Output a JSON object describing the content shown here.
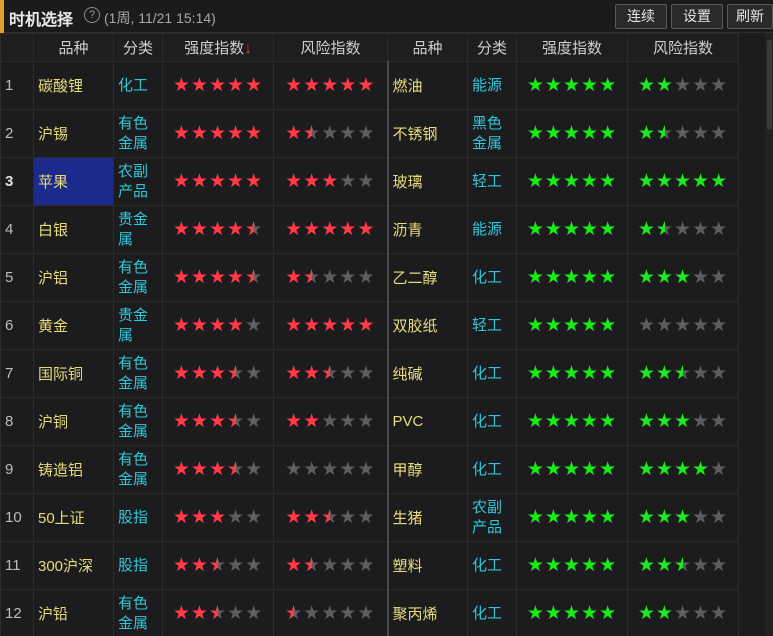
{
  "header": {
    "title": "时机选择",
    "subtitle": "(1周, 11/21 15:14)",
    "buttons": {
      "continuous": "连续",
      "settings": "设置",
      "refresh": "刷新"
    }
  },
  "columns": {
    "name": "品种",
    "category": "分类",
    "strength": "强度指数",
    "strength_sort": "↓",
    "risk": "风险指数",
    "name2": "品种",
    "category2": "分类",
    "strength2": "强度指数",
    "risk2": "风险指数"
  },
  "colors": {
    "strength_left": "#ff3b46",
    "risk_left": "#ff3b46",
    "right": "#1aeb1a",
    "empty": "#5e5e60",
    "selected": "#1b2a8c"
  },
  "rows": [
    {
      "idx": "1",
      "left": {
        "name": "碳酸锂",
        "cat": "化工",
        "strength": 5,
        "risk": 5
      },
      "right": {
        "name": "燃油",
        "cat": "能源",
        "strength": 5,
        "risk": 2
      }
    },
    {
      "idx": "2",
      "left": {
        "name": "沪锡",
        "cat": "有色金属",
        "strength": 5,
        "risk": 1.5
      },
      "right": {
        "name": "不锈钢",
        "cat": "黑色金属",
        "strength": 5,
        "risk": 1.5
      }
    },
    {
      "idx": "3",
      "left": {
        "name": "苹果",
        "cat": "农副产品",
        "strength": 5,
        "risk": 3
      },
      "right": {
        "name": "玻璃",
        "cat": "轻工",
        "strength": 5,
        "risk": 5
      }
    },
    {
      "idx": "4",
      "left": {
        "name": "白银",
        "cat": "贵金属",
        "strength": 4.5,
        "risk": 5
      },
      "right": {
        "name": "沥青",
        "cat": "能源",
        "strength": 5,
        "risk": 1.5
      }
    },
    {
      "idx": "5",
      "left": {
        "name": "沪铝",
        "cat": "有色金属",
        "strength": 4.5,
        "risk": 1.5
      },
      "right": {
        "name": "乙二醇",
        "cat": "化工",
        "strength": 5,
        "risk": 3
      }
    },
    {
      "idx": "6",
      "left": {
        "name": "黄金",
        "cat": "贵金属",
        "strength": 4,
        "risk": 5
      },
      "right": {
        "name": "双胶纸",
        "cat": "轻工",
        "strength": 5,
        "risk": 0
      }
    },
    {
      "idx": "7",
      "left": {
        "name": "国际铜",
        "cat": "有色金属",
        "strength": 3.5,
        "risk": 2.5
      },
      "right": {
        "name": "纯碱",
        "cat": "化工",
        "strength": 5,
        "risk": 2.5
      }
    },
    {
      "idx": "8",
      "left": {
        "name": "沪铜",
        "cat": "有色金属",
        "strength": 3.5,
        "risk": 2
      },
      "right": {
        "name": "PVC",
        "cat": "化工",
        "strength": 5,
        "risk": 3
      }
    },
    {
      "idx": "9",
      "left": {
        "name": "铸造铝",
        "cat": "有色金属",
        "strength": 3.5,
        "risk": 0
      },
      "right": {
        "name": "甲醇",
        "cat": "化工",
        "strength": 5,
        "risk": 4
      }
    },
    {
      "idx": "10",
      "left": {
        "name": "50上证",
        "cat": "股指",
        "strength": 3,
        "risk": 2.5
      },
      "right": {
        "name": "生猪",
        "cat": "农副产品",
        "strength": 5,
        "risk": 3
      }
    },
    {
      "idx": "11",
      "left": {
        "name": "300沪深",
        "cat": "股指",
        "strength": 2.5,
        "risk": 1.5
      },
      "right": {
        "name": "塑料",
        "cat": "化工",
        "strength": 5,
        "risk": 2.5
      }
    },
    {
      "idx": "12",
      "left": {
        "name": "沪铅",
        "cat": "有色金属",
        "strength": 2.5,
        "risk": 0.5
      },
      "right": {
        "name": "聚丙烯",
        "cat": "化工",
        "strength": 5,
        "risk": 2
      }
    }
  ],
  "selected_row": 2
}
